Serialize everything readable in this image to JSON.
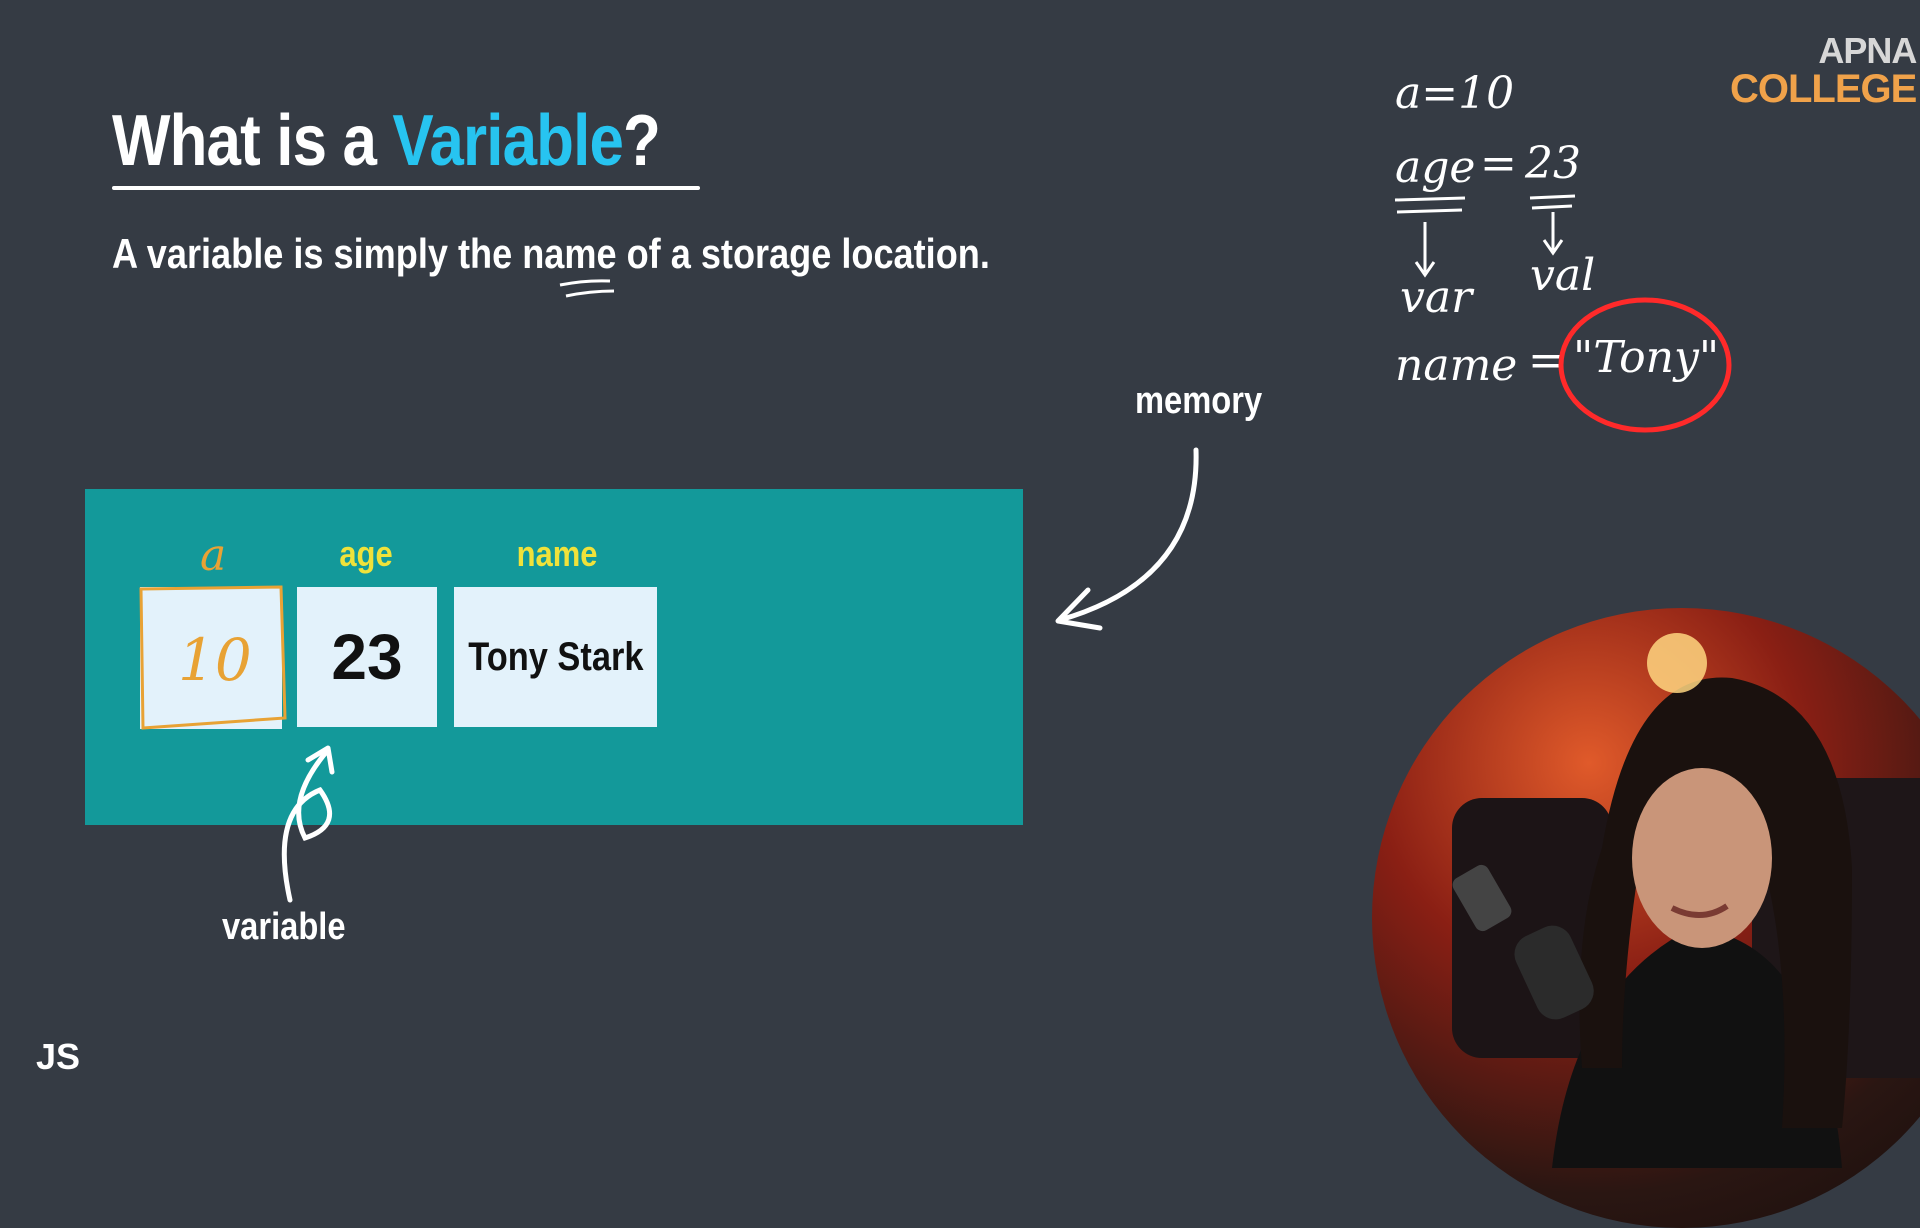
{
  "slide": {
    "title_prefix": "What is a ",
    "title_accent": "Variable",
    "title_suffix": "?",
    "subtitle": "A variable is simply the name of a storage location.",
    "accent_color": "#27c4f0"
  },
  "memory": {
    "label": "memory",
    "cells": [
      {
        "label": "a",
        "value": "10"
      },
      {
        "label": "age",
        "value": "23"
      },
      {
        "label": "name",
        "value": "Tony Stark"
      }
    ]
  },
  "variable_label": "variable",
  "corner_tag": "JS",
  "logo": {
    "line1": "APNA",
    "line2": "COLLEGE"
  },
  "annotations": {
    "line1": "a=10",
    "line2_name": "age",
    "line2_eq": "=",
    "line2_val": "23",
    "var_word": "var",
    "val_word": "val",
    "line3_name": "name",
    "line3_eq": "=",
    "line3_val": "\"Tony\""
  },
  "presenter": {
    "icon": "presenter-webcam"
  }
}
